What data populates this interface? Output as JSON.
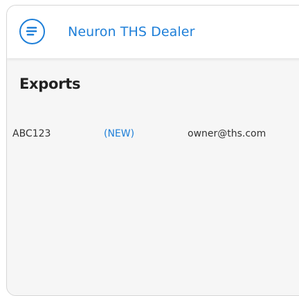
{
  "header": {
    "menu_icon": "menu-icon",
    "title": "Neuron THS Dealer"
  },
  "main": {
    "title": "Exports",
    "rows": [
      {
        "id": "ABC123",
        "status": "(NEW)",
        "owner": "owner@ths.com"
      }
    ]
  },
  "colors": {
    "accent": "#1e7fd8",
    "background": "#f6f6f6",
    "appbar": "#ffffff",
    "text": "#222222"
  }
}
